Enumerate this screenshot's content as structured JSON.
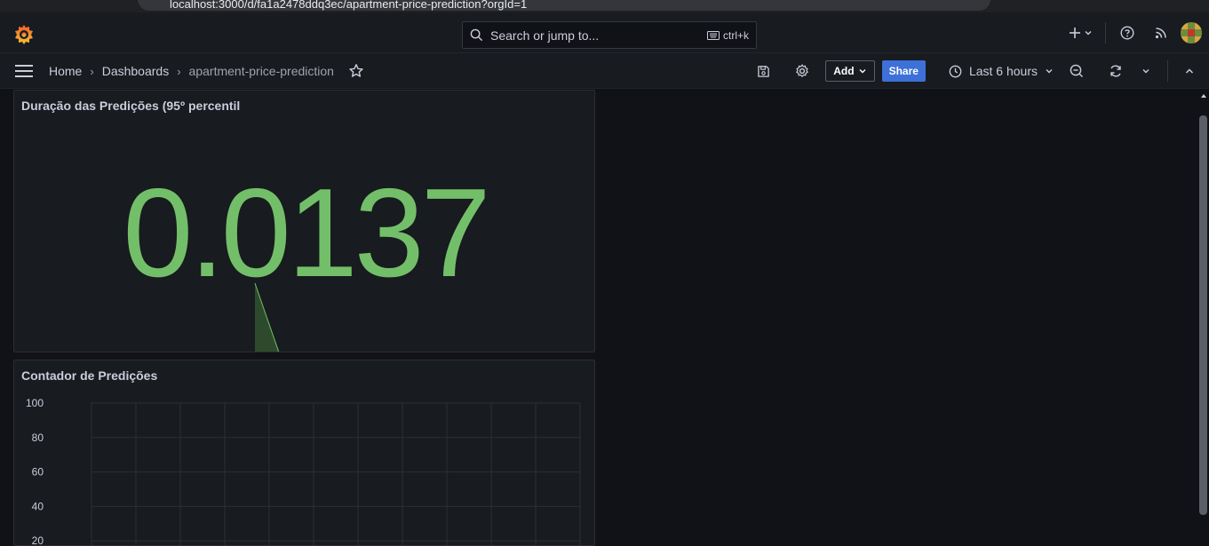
{
  "browser": {
    "url": "localhost:3000/d/fa1a2478ddq3ec/apartment-price-prediction?orgId=1"
  },
  "topbar": {
    "search_placeholder": "Search or jump to...",
    "shortcut": "ctrl+k"
  },
  "breadcrumb": {
    "items": [
      "Home",
      "Dashboards",
      "apartment-price-prediction"
    ],
    "separator": "›"
  },
  "toolbar": {
    "add_label": "Add",
    "share_label": "Share",
    "time_range": "Last 6 hours"
  },
  "panels": {
    "stat": {
      "title": "Duração das Predições (95º percentil",
      "value": "0.0137",
      "color": "#73bf69"
    },
    "graph": {
      "title": "Contador de Predições",
      "y_ticks": [
        "100",
        "80",
        "60",
        "40",
        "20"
      ]
    }
  },
  "chart_data": {
    "type": "line",
    "title": "Contador de Predições",
    "xlabel": "",
    "ylabel": "",
    "ylim": [
      0,
      100
    ],
    "yticks": [
      100,
      80,
      60,
      40,
      20
    ],
    "grid": true,
    "series": []
  },
  "colors": {
    "accent": "#3d71d9",
    "stat_green": "#73bf69",
    "background": "#111217",
    "panel": "#181b1f"
  }
}
